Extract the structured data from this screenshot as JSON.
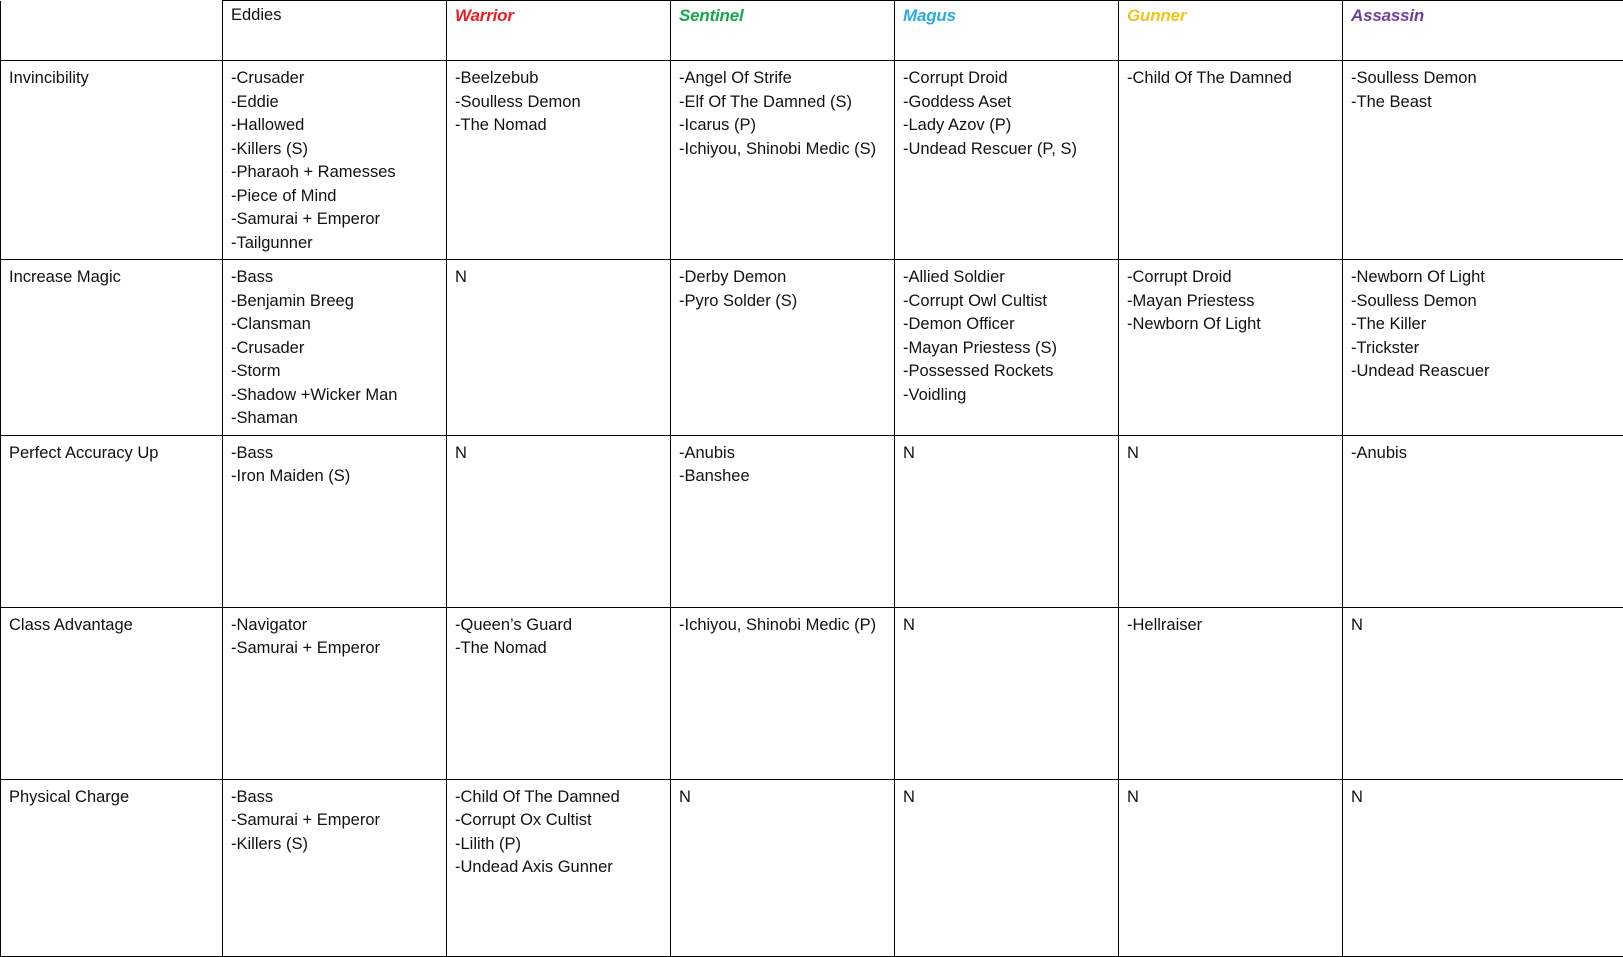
{
  "table": {
    "columns": [
      {
        "key": "label",
        "label": "",
        "style": "blank",
        "color": "#111111"
      },
      {
        "key": "eddies",
        "label": "Eddies",
        "style": "plain",
        "color": "#111111"
      },
      {
        "key": "warrior",
        "label": "Warrior",
        "style": "class",
        "color": "#ED1C24"
      },
      {
        "key": "sentinel",
        "label": "Sentinel",
        "style": "class",
        "color": "#17A74A"
      },
      {
        "key": "magus",
        "label": "Magus",
        "style": "class",
        "color": "#29ABE2"
      },
      {
        "key": "gunner",
        "label": "Gunner",
        "style": "class",
        "color": "#F1C41A"
      },
      {
        "key": "assassin",
        "label": "Assassin",
        "style": "class",
        "color": "#6B3FA0"
      }
    ],
    "none_marker": "N",
    "rows": [
      {
        "label": "Invincibility",
        "cells": {
          "eddies": [
            "-Crusader",
            "-Eddie",
            "-Hallowed",
            "-Killers (S)",
            "-Pharaoh + Ramesses",
            "-Piece of Mind",
            "-Samurai + Emperor",
            "-Tailgunner"
          ],
          "warrior": [
            "-Beelzebub",
            "-Soulless Demon",
            "-The Nomad"
          ],
          "sentinel": [
            "-Angel Of Strife",
            "-Elf Of The Damned (S)",
            "-Icarus (P)",
            "-Ichiyou, Shinobi Medic (S)"
          ],
          "magus": [
            "-Corrupt Droid",
            "-Goddess Aset",
            "-Lady Azov (P)",
            "-Undead Rescuer (P, S)"
          ],
          "gunner": [
            "-Child Of The Damned"
          ],
          "assassin": [
            "-Soulless Demon",
            "-The Beast"
          ]
        }
      },
      {
        "label": "Increase Magic",
        "cells": {
          "eddies": [
            "-Bass",
            "-Benjamin Breeg",
            "-Clansman",
            "-Crusader",
            "-Storm",
            "-Shadow +Wicker Man",
            "-Shaman"
          ],
          "warrior": [
            "N"
          ],
          "sentinel": [
            "-Derby Demon",
            "-Pyro Solder (S)"
          ],
          "magus": [
            "-Allied Soldier",
            "-Corrupt Owl Cultist",
            "-Demon Officer",
            "-Mayan Priestess (S)",
            "-Possessed Rockets",
            "-Voidling"
          ],
          "gunner": [
            "-Corrupt Droid",
            "-Mayan Priestess",
            "-Newborn Of Light"
          ],
          "assassin": [
            "-Newborn Of Light",
            "-Soulless Demon",
            "-The Killer",
            "-Trickster",
            "-Undead Reascuer"
          ]
        }
      },
      {
        "label": "Perfect Accuracy Up",
        "cells": {
          "eddies": [
            "-Bass",
            "-Iron Maiden (S)"
          ],
          "warrior": [
            "N"
          ],
          "sentinel": [
            "-Anubis",
            "-Banshee"
          ],
          "magus": [
            "N"
          ],
          "gunner": [
            "N"
          ],
          "assassin": [
            "-Anubis"
          ]
        }
      },
      {
        "label": "Class Advantage",
        "cells": {
          "eddies": [
            "-Navigator",
            "-Samurai + Emperor"
          ],
          "warrior": [
            "-Queen’s Guard",
            "-The Nomad"
          ],
          "sentinel": [
            "-Ichiyou, Shinobi Medic (P)"
          ],
          "magus": [
            "N"
          ],
          "gunner": [
            "-Hellraiser"
          ],
          "assassin": [
            "N"
          ]
        }
      },
      {
        "label": "Physical Charge",
        "cells": {
          "eddies": [
            "-Bass",
            "-Samurai + Emperor",
            "-Killers (S)"
          ],
          "warrior": [
            "-Child Of The Damned",
            "-Corrupt Ox Cultist",
            "-Lilith (P)",
            "-Undead Axis Gunner"
          ],
          "sentinel": [
            "N"
          ],
          "magus": [
            "N"
          ],
          "gunner": [
            "N"
          ],
          "assassin": [
            "N"
          ]
        }
      }
    ]
  }
}
